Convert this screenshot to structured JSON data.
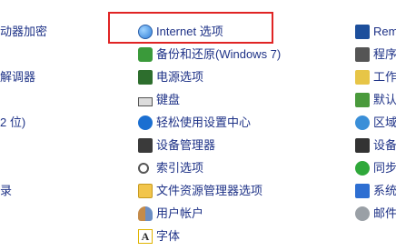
{
  "left_column": [
    {
      "label": "动器加密"
    },
    {
      "label": "解调器"
    },
    {
      "label": "2 位)"
    },
    {
      "label": "录"
    }
  ],
  "middle_column": [
    {
      "label": "Internet 选项",
      "icon": "internet-options-icon"
    },
    {
      "label": "备份和还原(Windows 7)",
      "icon": "backup-restore-icon"
    },
    {
      "label": "电源选项",
      "icon": "power-options-icon"
    },
    {
      "label": "键盘",
      "icon": "keyboard-icon"
    },
    {
      "label": "轻松使用设置中心",
      "icon": "ease-of-access-icon"
    },
    {
      "label": "设备管理器",
      "icon": "device-manager-icon"
    },
    {
      "label": "索引选项",
      "icon": "indexing-options-icon"
    },
    {
      "label": "文件资源管理器选项",
      "icon": "file-explorer-options-icon"
    },
    {
      "label": "用户帐户",
      "icon": "user-accounts-icon"
    },
    {
      "label": "字体",
      "icon": "fonts-icon"
    }
  ],
  "right_column": [
    {
      "label": "Rem",
      "icon": "remoteapp-icon"
    },
    {
      "label": "程序",
      "icon": "programs-icon"
    },
    {
      "label": "工作",
      "icon": "work-folders-icon"
    },
    {
      "label": "默认",
      "icon": "default-programs-icon"
    },
    {
      "label": "区域",
      "icon": "region-icon"
    },
    {
      "label": "设备",
      "icon": "devices-printers-icon"
    },
    {
      "label": "同步",
      "icon": "sync-center-icon"
    },
    {
      "label": "系统",
      "icon": "system-icon"
    },
    {
      "label": "邮件",
      "icon": "mail-icon"
    }
  ],
  "highlight": {
    "target": "Internet 选项",
    "color": "#e02424"
  },
  "colors": {
    "link": "#1e3287",
    "background": "#ffffff"
  }
}
